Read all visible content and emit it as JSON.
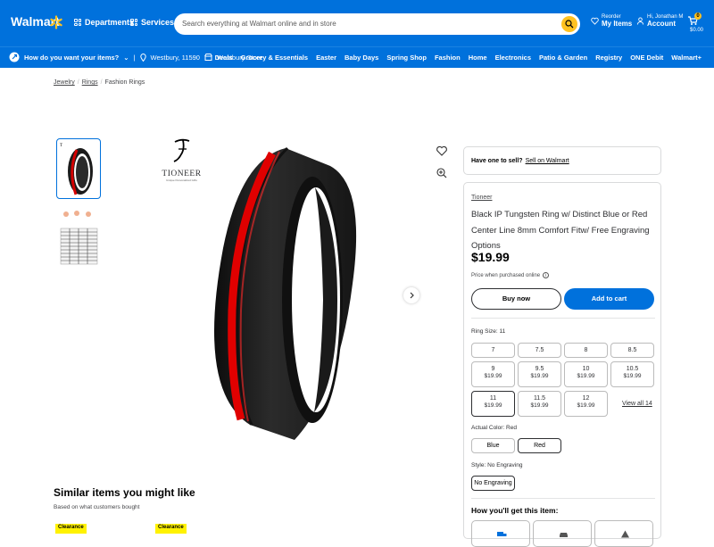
{
  "header": {
    "logo": "Walmart",
    "departments": "Departments",
    "services": "Services",
    "search_placeholder": "Search everything at Walmart online and in store",
    "reorder_line1": "Reorder",
    "reorder_line2": "My Items",
    "account_line1": "Hi, Jonathan M",
    "account_line2": "Account",
    "cart_count": "0",
    "cart_amount": "$0.00",
    "accent": "#0071dc",
    "spark_color": "#ffc220"
  },
  "subbar": {
    "delivery_prompt": "How do you want your items?",
    "location": "Westbury, 11590",
    "store": "Westbury Store",
    "nav": [
      "Deals",
      "Grocery & Essentials",
      "Easter",
      "Baby Days",
      "Spring Shop",
      "Fashion",
      "Home",
      "Electronics",
      "Patio & Garden",
      "Registry",
      "ONE Debit",
      "Walmart+"
    ]
  },
  "breadcrumb": [
    "Jewelry",
    "Rings",
    "Fashion Rings"
  ],
  "gallery": {
    "brand_logo_text": "TIONEER",
    "brand_logo_tagline": "Unique Personalized Gifts"
  },
  "similar": {
    "title": "Similar items you might like",
    "subtitle": "Based on what customers bought",
    "badges": [
      "Clearance",
      "Clearance"
    ]
  },
  "sell": {
    "prompt": "Have one to sell?",
    "link": "Sell on Walmart"
  },
  "product": {
    "brand": "Tioneer",
    "title": "Black IP Tungsten Ring w/ Distinct Blue or Red Center Line 8mm Comfort Fitw/ Free Engraving Options",
    "price": "$19.99",
    "price_note": "Price when purchased online",
    "buy_now": "Buy now",
    "add_to_cart": "Add to cart",
    "ring_size_label": "Ring Size:",
    "ring_size_value": "11",
    "sizes": [
      {
        "size": "7",
        "price": ""
      },
      {
        "size": "7.5",
        "price": ""
      },
      {
        "size": "8",
        "price": ""
      },
      {
        "size": "8.5",
        "price": ""
      },
      {
        "size": "9",
        "price": "$19.99"
      },
      {
        "size": "9.5",
        "price": "$19.99"
      },
      {
        "size": "10",
        "price": "$19.99"
      },
      {
        "size": "10.5",
        "price": "$19.99"
      },
      {
        "size": "11",
        "price": "$19.99"
      },
      {
        "size": "11.5",
        "price": "$19.99"
      },
      {
        "size": "12",
        "price": "$19.99"
      }
    ],
    "view_all": "View all 14",
    "color_label": "Actual Color:",
    "color_value": "Red",
    "colors": [
      "Blue",
      "Red"
    ],
    "style_label": "Style:",
    "style_value": "No Engraving",
    "styles": [
      "No Engraving"
    ],
    "how_title": "How you'll get this item:"
  }
}
